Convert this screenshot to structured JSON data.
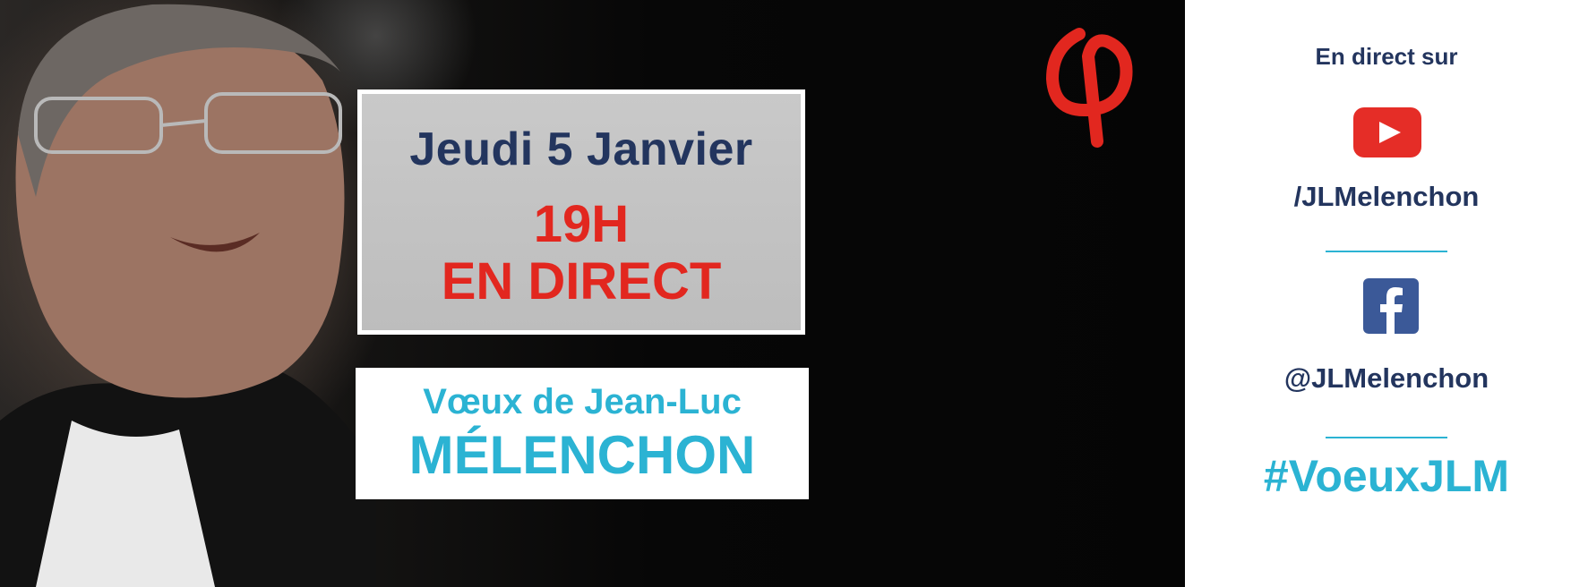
{
  "banner": {
    "date": "Jeudi 5 Janvier",
    "time": "19H",
    "live": "EN DIRECT",
    "title_line1": "Vœux de Jean-Luc",
    "title_line2": "MÉLENCHON"
  },
  "sidebar": {
    "live_on": "En direct sur",
    "youtube_handle": "/JLMelenchon",
    "facebook_handle": "@JLMelenchon",
    "hashtag": "#VoeuxJLM"
  },
  "icons": {
    "logo": "phi-logo-icon",
    "youtube": "youtube-icon",
    "facebook": "facebook-icon"
  },
  "colors": {
    "navy": "#23355e",
    "red": "#e2271f",
    "cyan": "#2bb3d3",
    "youtube_red": "#e52d27",
    "facebook_blue": "#3b5998"
  }
}
